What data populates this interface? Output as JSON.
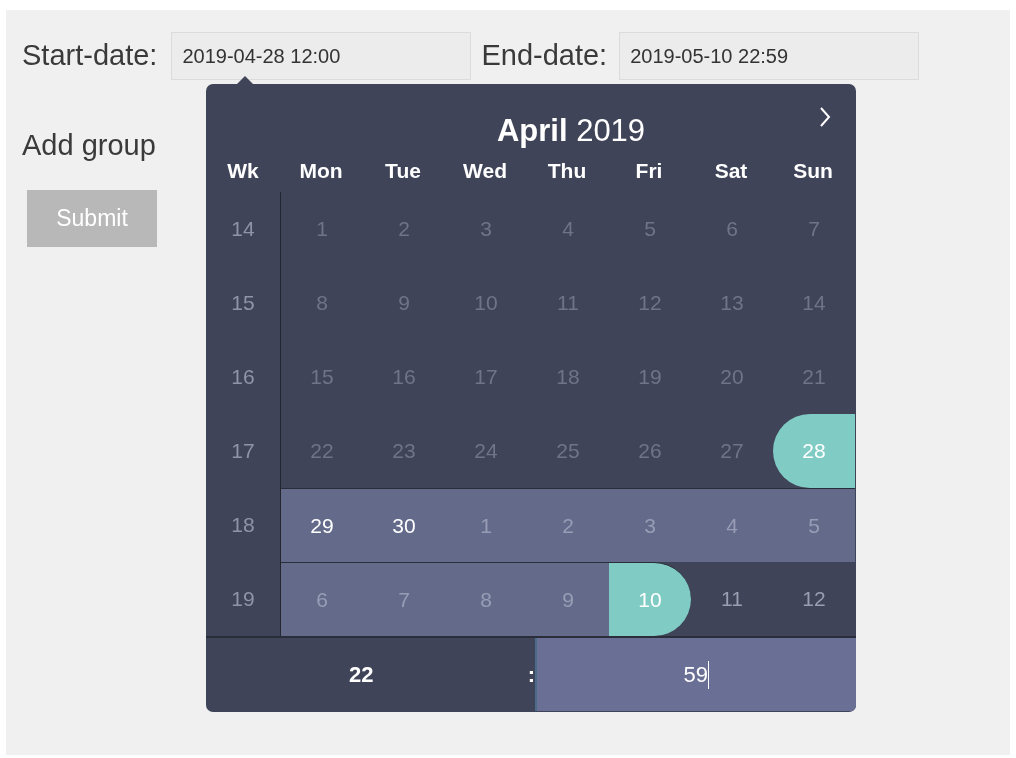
{
  "form": {
    "start_label": "Start-date:",
    "start_value": "2019-04-28 12:00",
    "end_label": "End-date:",
    "end_value": "2019-05-10 22:59",
    "groups_label": "Add group",
    "submit": "Submit"
  },
  "calendar": {
    "month": "April",
    "year": "2019",
    "week_header": "Wk",
    "weekdays": [
      "Mon",
      "Tue",
      "Wed",
      "Thu",
      "Fri",
      "Sat",
      "Sun"
    ],
    "weeks": [
      {
        "number": "14",
        "days": [
          {
            "text": "1",
            "kind": "disabled",
            "other_month": false
          },
          {
            "text": "2",
            "kind": "disabled",
            "other_month": false
          },
          {
            "text": "3",
            "kind": "disabled",
            "other_month": false
          },
          {
            "text": "4",
            "kind": "disabled",
            "other_month": false
          },
          {
            "text": "5",
            "kind": "disabled",
            "other_month": false
          },
          {
            "text": "6",
            "kind": "disabled",
            "other_month": false
          },
          {
            "text": "7",
            "kind": "disabled",
            "other_month": false
          }
        ]
      },
      {
        "number": "15",
        "days": [
          {
            "text": "8",
            "kind": "disabled",
            "other_month": false
          },
          {
            "text": "9",
            "kind": "disabled",
            "other_month": false
          },
          {
            "text": "10",
            "kind": "disabled",
            "other_month": false
          },
          {
            "text": "11",
            "kind": "disabled",
            "other_month": false
          },
          {
            "text": "12",
            "kind": "disabled",
            "other_month": false
          },
          {
            "text": "13",
            "kind": "disabled",
            "other_month": false
          },
          {
            "text": "14",
            "kind": "disabled",
            "other_month": false
          }
        ]
      },
      {
        "number": "16",
        "days": [
          {
            "text": "15",
            "kind": "disabled",
            "other_month": false
          },
          {
            "text": "16",
            "kind": "disabled",
            "other_month": false
          },
          {
            "text": "17",
            "kind": "disabled",
            "other_month": false
          },
          {
            "text": "18",
            "kind": "disabled",
            "other_month": false
          },
          {
            "text": "19",
            "kind": "disabled",
            "other_month": false
          },
          {
            "text": "20",
            "kind": "disabled",
            "other_month": false
          },
          {
            "text": "21",
            "kind": "disabled",
            "other_month": false
          }
        ]
      },
      {
        "number": "17",
        "days": [
          {
            "text": "22",
            "kind": "disabled",
            "other_month": false
          },
          {
            "text": "23",
            "kind": "disabled",
            "other_month": false
          },
          {
            "text": "24",
            "kind": "disabled",
            "other_month": false
          },
          {
            "text": "25",
            "kind": "disabled",
            "other_month": false
          },
          {
            "text": "26",
            "kind": "disabled",
            "other_month": false
          },
          {
            "text": "27",
            "kind": "disabled",
            "other_month": false
          },
          {
            "text": "28",
            "kind": "range_start"
          }
        ]
      },
      {
        "number": "18",
        "days": [
          {
            "text": "29",
            "kind": "range",
            "other_month": false
          },
          {
            "text": "30",
            "kind": "range",
            "other_month": false
          },
          {
            "text": "1",
            "kind": "range",
            "other_month": true
          },
          {
            "text": "2",
            "kind": "range",
            "other_month": true
          },
          {
            "text": "3",
            "kind": "range",
            "other_month": true
          },
          {
            "text": "4",
            "kind": "range",
            "other_month": true
          },
          {
            "text": "5",
            "kind": "range",
            "other_month": true
          }
        ]
      },
      {
        "number": "19",
        "days": [
          {
            "text": "6",
            "kind": "range",
            "other_month": true
          },
          {
            "text": "7",
            "kind": "range",
            "other_month": true
          },
          {
            "text": "8",
            "kind": "range",
            "other_month": true
          },
          {
            "text": "9",
            "kind": "range",
            "other_month": true
          },
          {
            "text": "10",
            "kind": "range_end"
          },
          {
            "text": "11",
            "kind": "plain",
            "other_month": true
          },
          {
            "text": "12",
            "kind": "plain",
            "other_month": true
          }
        ]
      }
    ]
  },
  "time": {
    "hour": "22",
    "separator": ":",
    "minute": "59"
  }
}
